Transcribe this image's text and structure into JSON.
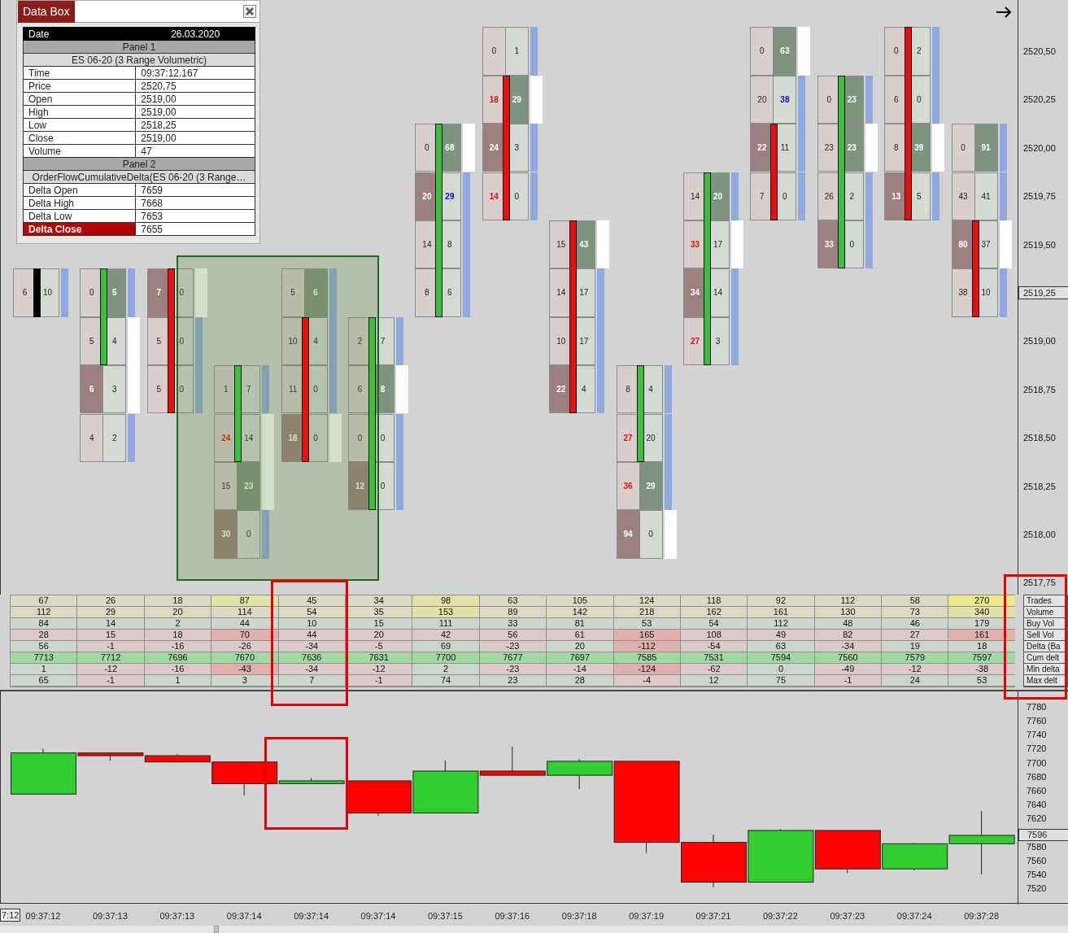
{
  "data_box": {
    "title": "Data Box",
    "rows": [
      {
        "kind": "header",
        "label": "Date",
        "value": "26.03.2020"
      },
      {
        "kind": "section",
        "text": "Panel 1"
      },
      {
        "kind": "subtitle",
        "text": "ES 06-20 (3 Range Volumetric)"
      },
      {
        "kind": "field",
        "label": "Time",
        "value": "09:37:12.167",
        "highlight": false
      },
      {
        "kind": "field",
        "label": "Price",
        "value": "2520,75",
        "highlight": false
      },
      {
        "kind": "field",
        "label": "Open",
        "value": "2519,00",
        "highlight": false
      },
      {
        "kind": "field",
        "label": "High",
        "value": "2519,00",
        "highlight": false
      },
      {
        "kind": "field",
        "label": "Low",
        "value": "2518,25",
        "highlight": false
      },
      {
        "kind": "field",
        "label": "Close",
        "value": "2519,00",
        "highlight": false
      },
      {
        "kind": "field",
        "label": "Volume",
        "value": "47",
        "highlight": false
      },
      {
        "kind": "section",
        "text": "Panel 2"
      },
      {
        "kind": "subtitle",
        "text": "OrderFlowCumulativeDelta(ES 06-20 (3 Range…"
      },
      {
        "kind": "field",
        "label": "Delta Open",
        "value": "7659",
        "highlight": false
      },
      {
        "kind": "field",
        "label": "Delta High",
        "value": "7668",
        "highlight": false
      },
      {
        "kind": "field",
        "label": "Delta Low",
        "value": "7653",
        "highlight": false
      },
      {
        "kind": "field",
        "label": "Delta Close",
        "value": "7655",
        "highlight": true
      }
    ]
  },
  "price_axis": [
    {
      "label": "2520,50",
      "current": false
    },
    {
      "label": "2520,25",
      "current": false
    },
    {
      "label": "2520,00",
      "current": false
    },
    {
      "label": "2519,75",
      "current": false
    },
    {
      "label": "2519,50",
      "current": false
    },
    {
      "label": "2519,25",
      "current": true
    },
    {
      "label": "2519,00",
      "current": false
    },
    {
      "label": "2518,75",
      "current": false
    },
    {
      "label": "2518,50",
      "current": false
    },
    {
      "label": "2518,25",
      "current": false
    },
    {
      "label": "2518,00",
      "current": false
    },
    {
      "label": "2517,75",
      "current": false
    }
  ],
  "bars": [
    {
      "color": "#000000",
      "rows": [
        null,
        null,
        null,
        null,
        null,
        {
          "bid": {
            "value": "6",
            "kind": "plain"
          },
          "ask": {
            "value": "10",
            "kind": "plain"
          },
          "body": true,
          "poc": false
        }
      ]
    },
    {
      "color": "#3cbf3c",
      "rows": [
        null,
        null,
        null,
        null,
        null,
        {
          "bid": {
            "value": "0",
            "kind": "plain"
          },
          "ask": {
            "value": "5",
            "kind": "light"
          },
          "body": true,
          "poc": false
        },
        {
          "bid": {
            "value": "5",
            "kind": "plain"
          },
          "ask": {
            "value": "4",
            "kind": "plain"
          },
          "body": true,
          "poc": true
        },
        {
          "bid": {
            "value": "6",
            "kind": "light"
          },
          "ask": {
            "value": "3",
            "kind": "plain"
          },
          "body": false,
          "poc": true
        },
        {
          "bid": {
            "value": "4",
            "kind": "plain"
          },
          "ask": {
            "value": "2",
            "kind": "plain"
          },
          "body": false,
          "poc": false
        }
      ]
    },
    {
      "color": "#e61010",
      "rows": [
        null,
        null,
        null,
        null,
        null,
        {
          "bid": {
            "value": "7",
            "kind": "light"
          },
          "ask": {
            "value": "0",
            "kind": "plain"
          },
          "body": true,
          "poc": true
        },
        {
          "bid": {
            "value": "5",
            "kind": "plain"
          },
          "ask": {
            "value": "0",
            "kind": "plain"
          },
          "body": true,
          "poc": false
        },
        {
          "bid": {
            "value": "5",
            "kind": "plain"
          },
          "ask": {
            "value": "0",
            "kind": "plain"
          },
          "body": true,
          "poc": false
        }
      ]
    },
    {
      "color": "#3cbf3c",
      "rows": [
        null,
        null,
        null,
        null,
        null,
        null,
        null,
        {
          "bid": {
            "value": "1",
            "kind": "plain"
          },
          "ask": {
            "value": "7",
            "kind": "plain"
          },
          "body": true,
          "poc": false
        },
        {
          "bid": {
            "value": "24",
            "kind": "strong"
          },
          "ask": {
            "value": "14",
            "kind": "plain"
          },
          "body": true,
          "poc": true
        },
        {
          "bid": {
            "value": "15",
            "kind": "plain"
          },
          "ask": {
            "value": "23",
            "kind": "light"
          },
          "body": false,
          "poc": true
        },
        {
          "bid": {
            "value": "30",
            "kind": "light"
          },
          "ask": {
            "value": "0",
            "kind": "plain"
          },
          "body": false,
          "poc": false
        }
      ]
    },
    {
      "color": "#e61010",
      "rows": [
        null,
        null,
        null,
        null,
        null,
        {
          "bid": {
            "value": "5",
            "kind": "plain"
          },
          "ask": {
            "value": "6",
            "kind": "light"
          },
          "body": false,
          "poc": false
        },
        {
          "bid": {
            "value": "10",
            "kind": "plain"
          },
          "ask": {
            "value": "4",
            "kind": "plain"
          },
          "body": true,
          "poc": false
        },
        {
          "bid": {
            "value": "11",
            "kind": "plain"
          },
          "ask": {
            "value": "0",
            "kind": "plain"
          },
          "body": true,
          "poc": false
        },
        {
          "bid": {
            "value": "18",
            "kind": "light"
          },
          "ask": {
            "value": "0",
            "kind": "plain"
          },
          "body": true,
          "poc": true
        }
      ]
    },
    {
      "color": "#3cbf3c",
      "rows": [
        null,
        null,
        null,
        null,
        null,
        null,
        {
          "bid": {
            "value": "2",
            "kind": "plain"
          },
          "ask": {
            "value": "7",
            "kind": "plain"
          },
          "body": true,
          "poc": false
        },
        {
          "bid": {
            "value": "6",
            "kind": "plain"
          },
          "ask": {
            "value": "8",
            "kind": "light"
          },
          "body": true,
          "poc": true
        },
        {
          "bid": {
            "value": "0",
            "kind": "plain"
          },
          "ask": {
            "value": "0",
            "kind": "plain"
          },
          "body": true,
          "poc": false
        },
        {
          "bid": {
            "value": "12",
            "kind": "light"
          },
          "ask": {
            "value": "0",
            "kind": "plain"
          },
          "body": true,
          "poc": false
        }
      ]
    },
    {
      "color": "#3cbf3c",
      "rows": [
        null,
        null,
        {
          "bid": {
            "value": "0",
            "kind": "plain"
          },
          "ask": {
            "value": "68",
            "kind": "light"
          },
          "body": true,
          "poc": true
        },
        {
          "bid": {
            "value": "20",
            "kind": "light"
          },
          "ask": {
            "value": "29",
            "kind": "strong"
          },
          "body": true,
          "poc": false
        },
        {
          "bid": {
            "value": "14",
            "kind": "plain"
          },
          "ask": {
            "value": "8",
            "kind": "plain"
          },
          "body": true,
          "poc": false
        },
        {
          "bid": {
            "value": "8",
            "kind": "plain"
          },
          "ask": {
            "value": "6",
            "kind": "plain"
          },
          "body": true,
          "poc": false
        }
      ]
    },
    {
      "color": "#e61010",
      "rows": [
        {
          "bid": {
            "value": "0",
            "kind": "plain"
          },
          "ask": {
            "value": "1",
            "kind": "plain"
          },
          "body": false,
          "poc": false
        },
        {
          "bid": {
            "value": "18",
            "kind": "strong"
          },
          "ask": {
            "value": "29",
            "kind": "light"
          },
          "body": true,
          "poc": true
        },
        {
          "bid": {
            "value": "24",
            "kind": "light"
          },
          "ask": {
            "value": "3",
            "kind": "plain"
          },
          "body": true,
          "poc": false
        },
        {
          "bid": {
            "value": "14",
            "kind": "strong"
          },
          "ask": {
            "value": "0",
            "kind": "plain"
          },
          "body": true,
          "poc": false
        }
      ]
    },
    {
      "color": "#e61010",
      "rows": [
        null,
        null,
        null,
        null,
        {
          "bid": {
            "value": "15",
            "kind": "plain"
          },
          "ask": {
            "value": "43",
            "kind": "light"
          },
          "body": true,
          "poc": true
        },
        {
          "bid": {
            "value": "14",
            "kind": "plain"
          },
          "ask": {
            "value": "17",
            "kind": "plain"
          },
          "body": true,
          "poc": false
        },
        {
          "bid": {
            "value": "10",
            "kind": "plain"
          },
          "ask": {
            "value": "17",
            "kind": "plain"
          },
          "body": true,
          "poc": false
        },
        {
          "bid": {
            "value": "22",
            "kind": "light"
          },
          "ask": {
            "value": "4",
            "kind": "plain"
          },
          "body": true,
          "poc": false
        }
      ]
    },
    {
      "color": "#3cbf3c",
      "rows": [
        null,
        null,
        null,
        null,
        null,
        null,
        null,
        {
          "bid": {
            "value": "8",
            "kind": "plain"
          },
          "ask": {
            "value": "4",
            "kind": "plain"
          },
          "body": true,
          "poc": false
        },
        {
          "bid": {
            "value": "27",
            "kind": "strong"
          },
          "ask": {
            "value": "20",
            "kind": "plain"
          },
          "body": true,
          "poc": false
        },
        {
          "bid": {
            "value": "36",
            "kind": "strong"
          },
          "ask": {
            "value": "29",
            "kind": "light"
          },
          "body": false,
          "poc": false
        },
        {
          "bid": {
            "value": "94",
            "kind": "light"
          },
          "ask": {
            "value": "0",
            "kind": "plain"
          },
          "body": false,
          "poc": true
        }
      ]
    },
    {
      "color": "#3cbf3c",
      "rows": [
        null,
        null,
        null,
        {
          "bid": {
            "value": "14",
            "kind": "plain"
          },
          "ask": {
            "value": "20",
            "kind": "light"
          },
          "body": true,
          "poc": false
        },
        {
          "bid": {
            "value": "33",
            "kind": "strong"
          },
          "ask": {
            "value": "17",
            "kind": "plain"
          },
          "body": true,
          "poc": true
        },
        {
          "bid": {
            "value": "34",
            "kind": "light"
          },
          "ask": {
            "value": "14",
            "kind": "plain"
          },
          "body": true,
          "poc": false
        },
        {
          "bid": {
            "value": "27",
            "kind": "strong"
          },
          "ask": {
            "value": "3",
            "kind": "plain"
          },
          "body": true,
          "poc": false
        }
      ]
    },
    {
      "color": "#e61010",
      "rows": [
        {
          "bid": {
            "value": "0",
            "kind": "plain"
          },
          "ask": {
            "value": "63",
            "kind": "light"
          },
          "body": false,
          "poc": true
        },
        {
          "bid": {
            "value": "20",
            "kind": "plain"
          },
          "ask": {
            "value": "38",
            "kind": "strong"
          },
          "body": false,
          "poc": false
        },
        {
          "bid": {
            "value": "22",
            "kind": "light"
          },
          "ask": {
            "value": "11",
            "kind": "plain"
          },
          "body": true,
          "poc": false
        },
        {
          "bid": {
            "value": "7",
            "kind": "plain"
          },
          "ask": {
            "value": "0",
            "kind": "plain"
          },
          "body": true,
          "poc": false
        }
      ]
    },
    {
      "color": "#3cbf3c",
      "rows": [
        null,
        {
          "bid": {
            "value": "0",
            "kind": "plain"
          },
          "ask": {
            "value": "23",
            "kind": "light"
          },
          "body": true,
          "poc": false
        },
        {
          "bid": {
            "value": "23",
            "kind": "plain"
          },
          "ask": {
            "value": "23",
            "kind": "light"
          },
          "body": true,
          "poc": true
        },
        {
          "bid": {
            "value": "26",
            "kind": "plain"
          },
          "ask": {
            "value": "2",
            "kind": "plain"
          },
          "body": true,
          "poc": false
        },
        {
          "bid": {
            "value": "33",
            "kind": "light"
          },
          "ask": {
            "value": "0",
            "kind": "plain"
          },
          "body": true,
          "poc": false
        }
      ]
    },
    {
      "color": "#e61010",
      "rows": [
        {
          "bid": {
            "value": "0",
            "kind": "plain"
          },
          "ask": {
            "value": "2",
            "kind": "plain"
          },
          "body": true,
          "poc": false
        },
        {
          "bid": {
            "value": "6",
            "kind": "plain"
          },
          "ask": {
            "value": "0",
            "kind": "plain"
          },
          "body": true,
          "poc": false
        },
        {
          "bid": {
            "value": "8",
            "kind": "plain"
          },
          "ask": {
            "value": "39",
            "kind": "light"
          },
          "body": true,
          "poc": true
        },
        {
          "bid": {
            "value": "13",
            "kind": "light"
          },
          "ask": {
            "value": "5",
            "kind": "plain"
          },
          "body": true,
          "poc": false
        }
      ]
    },
    {
      "color": "#e61010",
      "rows": [
        null,
        null,
        {
          "bid": {
            "value": "0",
            "kind": "plain"
          },
          "ask": {
            "value": "91",
            "kind": "light"
          },
          "body": false,
          "poc": false
        },
        {
          "bid": {
            "value": "43",
            "kind": "plain"
          },
          "ask": {
            "value": "41",
            "kind": "plain"
          },
          "body": false,
          "poc": false
        },
        {
          "bid": {
            "value": "80",
            "kind": "light"
          },
          "ask": {
            "value": "37",
            "kind": "plain"
          },
          "body": true,
          "poc": true
        },
        {
          "bid": {
            "value": "38",
            "kind": "plain"
          },
          "ask": {
            "value": "10",
            "kind": "plain"
          },
          "body": true,
          "poc": false
        }
      ]
    }
  ],
  "table": {
    "rows": [
      {
        "label": "Trades",
        "cells": [
          {
            "value": "67",
            "color": "#dadac2"
          },
          {
            "value": "26",
            "color": "#dadac2"
          },
          {
            "value": "18",
            "color": "#dadac2"
          },
          {
            "value": "87",
            "color": "#e2e2a8"
          },
          {
            "value": "45",
            "color": "#dadac2"
          },
          {
            "value": "34",
            "color": "#dadac2"
          },
          {
            "value": "98",
            "color": "#e2e2a8"
          },
          {
            "value": "63",
            "color": "#dadac2"
          },
          {
            "value": "105",
            "color": "#dadac2"
          },
          {
            "value": "124",
            "color": "#dadac2"
          },
          {
            "value": "118",
            "color": "#dadac2"
          },
          {
            "value": "92",
            "color": "#dadac2"
          },
          {
            "value": "112",
            "color": "#dadac2"
          },
          {
            "value": "58",
            "color": "#dadac2"
          },
          {
            "value": "270",
            "color": "#eaea88"
          }
        ]
      },
      {
        "label": "Volume",
        "cells": [
          {
            "value": "112",
            "color": "#dadac2"
          },
          {
            "value": "29",
            "color": "#dadac2"
          },
          {
            "value": "20",
            "color": "#dadac2"
          },
          {
            "value": "114",
            "color": "#dadac2"
          },
          {
            "value": "54",
            "color": "#dadac2"
          },
          {
            "value": "35",
            "color": "#dadac2"
          },
          {
            "value": "153",
            "color": "#e2e2a8"
          },
          {
            "value": "89",
            "color": "#dadac2"
          },
          {
            "value": "142",
            "color": "#dadac2"
          },
          {
            "value": "218",
            "color": "#dadac2"
          },
          {
            "value": "162",
            "color": "#dadac2"
          },
          {
            "value": "161",
            "color": "#dadac2"
          },
          {
            "value": "130",
            "color": "#dadac2"
          },
          {
            "value": "73",
            "color": "#dadac2"
          },
          {
            "value": "340",
            "color": "#e2e2a8"
          }
        ]
      },
      {
        "label": "Buy Vol",
        "cells": [
          {
            "value": "84",
            "color": "#ccd6cc"
          },
          {
            "value": "14",
            "color": "#ccd6cc"
          },
          {
            "value": "2",
            "color": "#ccd6cc"
          },
          {
            "value": "44",
            "color": "#ccd6cc"
          },
          {
            "value": "10",
            "color": "#ccd6cc"
          },
          {
            "value": "15",
            "color": "#ccd6cc"
          },
          {
            "value": "111",
            "color": "#ccd6cc"
          },
          {
            "value": "33",
            "color": "#ccd6cc"
          },
          {
            "value": "81",
            "color": "#ccd6cc"
          },
          {
            "value": "53",
            "color": "#ccd6cc"
          },
          {
            "value": "54",
            "color": "#ccd6cc"
          },
          {
            "value": "112",
            "color": "#ccd6cc"
          },
          {
            "value": "48",
            "color": "#ccd6cc"
          },
          {
            "value": "46",
            "color": "#ccd6cc"
          },
          {
            "value": "179",
            "color": "#ccd6cc"
          }
        ]
      },
      {
        "label": "Sell Vol",
        "cells": [
          {
            "value": "28",
            "color": "#dccaca"
          },
          {
            "value": "15",
            "color": "#dccaca"
          },
          {
            "value": "18",
            "color": "#dccaca"
          },
          {
            "value": "70",
            "color": "#e2afaf"
          },
          {
            "value": "44",
            "color": "#dccaca"
          },
          {
            "value": "20",
            "color": "#dccaca"
          },
          {
            "value": "42",
            "color": "#dccaca"
          },
          {
            "value": "56",
            "color": "#dccaca"
          },
          {
            "value": "61",
            "color": "#dccaca"
          },
          {
            "value": "165",
            "color": "#e2afaf"
          },
          {
            "value": "108",
            "color": "#dccaca"
          },
          {
            "value": "49",
            "color": "#dccaca"
          },
          {
            "value": "82",
            "color": "#dccaca"
          },
          {
            "value": "27",
            "color": "#dccaca"
          },
          {
            "value": "161",
            "color": "#e2afaf"
          }
        ]
      },
      {
        "label": "Delta (Ba",
        "cells": [
          {
            "value": "56",
            "color": "#ccd6cc"
          },
          {
            "value": "-1",
            "color": "#dccaca"
          },
          {
            "value": "-16",
            "color": "#dccaca"
          },
          {
            "value": "-26",
            "color": "#dccaca"
          },
          {
            "value": "-34",
            "color": "#dccaca"
          },
          {
            "value": "-5",
            "color": "#dccaca"
          },
          {
            "value": "69",
            "color": "#ccd6cc"
          },
          {
            "value": "-23",
            "color": "#dccaca"
          },
          {
            "value": "20",
            "color": "#ccd6cc"
          },
          {
            "value": "-112",
            "color": "#e2afaf"
          },
          {
            "value": "-54",
            "color": "#dccaca"
          },
          {
            "value": "63",
            "color": "#ccd6cc"
          },
          {
            "value": "-34",
            "color": "#dccaca"
          },
          {
            "value": "19",
            "color": "#ccd6cc"
          },
          {
            "value": "18",
            "color": "#ccd6cc"
          }
        ]
      },
      {
        "label": "Cum delt",
        "cells": [
          {
            "value": "7713",
            "color": "#a3d7a3"
          },
          {
            "value": "7712",
            "color": "#a3d7a3"
          },
          {
            "value": "7696",
            "color": "#a3d7a3"
          },
          {
            "value": "7670",
            "color": "#a3d7a3"
          },
          {
            "value": "7636",
            "color": "#a3d7a3"
          },
          {
            "value": "7631",
            "color": "#a3d7a3"
          },
          {
            "value": "7700",
            "color": "#a3d7a3"
          },
          {
            "value": "7677",
            "color": "#a3d7a3"
          },
          {
            "value": "7697",
            "color": "#a3d7a3"
          },
          {
            "value": "7585",
            "color": "#a3d7a3"
          },
          {
            "value": "7531",
            "color": "#a3d7a3"
          },
          {
            "value": "7594",
            "color": "#a3d7a3"
          },
          {
            "value": "7560",
            "color": "#a3d7a3"
          },
          {
            "value": "7579",
            "color": "#a3d7a3"
          },
          {
            "value": "7597",
            "color": "#a3d7a3"
          }
        ]
      },
      {
        "label": "Min delta",
        "cells": [
          {
            "value": "1",
            "color": "#ccd6cc"
          },
          {
            "value": "-12",
            "color": "#dccaca"
          },
          {
            "value": "-16",
            "color": "#dccaca"
          },
          {
            "value": "-43",
            "color": "#e2afaf"
          },
          {
            "value": "-34",
            "color": "#dccaca"
          },
          {
            "value": "-12",
            "color": "#dccaca"
          },
          {
            "value": "2",
            "color": "#ccd6cc"
          },
          {
            "value": "-23",
            "color": "#dccaca"
          },
          {
            "value": "-14",
            "color": "#dccaca"
          },
          {
            "value": "-124",
            "color": "#e2afaf"
          },
          {
            "value": "-62",
            "color": "#dccaca"
          },
          {
            "value": "0",
            "color": "#ccd6cc"
          },
          {
            "value": "-49",
            "color": "#dccaca"
          },
          {
            "value": "-12",
            "color": "#dccaca"
          },
          {
            "value": "-38",
            "color": "#dccaca"
          }
        ]
      },
      {
        "label": "Max delt",
        "cells": [
          {
            "value": "65",
            "color": "#ccd6cc"
          },
          {
            "value": "-1",
            "color": "#dccaca"
          },
          {
            "value": "1",
            "color": "#ccd6cc"
          },
          {
            "value": "3",
            "color": "#ccd6cc"
          },
          {
            "value": "7",
            "color": "#ccd6cc"
          },
          {
            "value": "-1",
            "color": "#dccaca"
          },
          {
            "value": "74",
            "color": "#ccd6cc"
          },
          {
            "value": "23",
            "color": "#ccd6cc"
          },
          {
            "value": "28",
            "color": "#ccd6cc"
          },
          {
            "value": "-4",
            "color": "#dccaca"
          },
          {
            "value": "12",
            "color": "#ccd6cc"
          },
          {
            "value": "75",
            "color": "#ccd6cc"
          },
          {
            "value": "-1",
            "color": "#dccaca"
          },
          {
            "value": "24",
            "color": "#ccd6cc"
          },
          {
            "value": "53",
            "color": "#ccd6cc"
          }
        ]
      }
    ]
  },
  "delta_panel": {
    "current_value": "7596",
    "chart_data": {
      "type": "candlestick",
      "ylim": [
        7497,
        7802
      ],
      "yticks": [
        7780,
        7760,
        7740,
        7720,
        7700,
        7680,
        7660,
        7640,
        7620,
        7580,
        7560,
        7540,
        7520
      ],
      "categories": [
        "09:37:12",
        "09:37:13",
        "09:37:13",
        "09:37:14",
        "09:37:14",
        "09:37:14",
        "09:37:15",
        "09:37:16",
        "09:37:18",
        "09:37:19",
        "09:37:21",
        "09:37:22",
        "09:37:23",
        "09:37:24",
        "09:37:28"
      ],
      "ohlc": [
        [
          7655,
          7720,
          7655,
          7714
        ],
        [
          7714,
          7714,
          7703,
          7710
        ],
        [
          7710,
          7712,
          7701,
          7701
        ],
        [
          7701,
          7701,
          7653,
          7670
        ],
        [
          7670,
          7678,
          7670,
          7674
        ],
        [
          7674,
          7674,
          7624,
          7628
        ],
        [
          7628,
          7703,
          7628,
          7688
        ],
        [
          7688,
          7723,
          7682,
          7682
        ],
        [
          7682,
          7705,
          7662,
          7702
        ],
        [
          7702,
          7702,
          7571,
          7586
        ],
        [
          7586,
          7597,
          7522,
          7529
        ],
        [
          7529,
          7605,
          7529,
          7603
        ],
        [
          7603,
          7603,
          7542,
          7548
        ],
        [
          7548,
          7585,
          7546,
          7584
        ],
        [
          7584,
          7631,
          7540,
          7596
        ]
      ]
    }
  },
  "time_axis": {
    "cursor": "7:12"
  }
}
